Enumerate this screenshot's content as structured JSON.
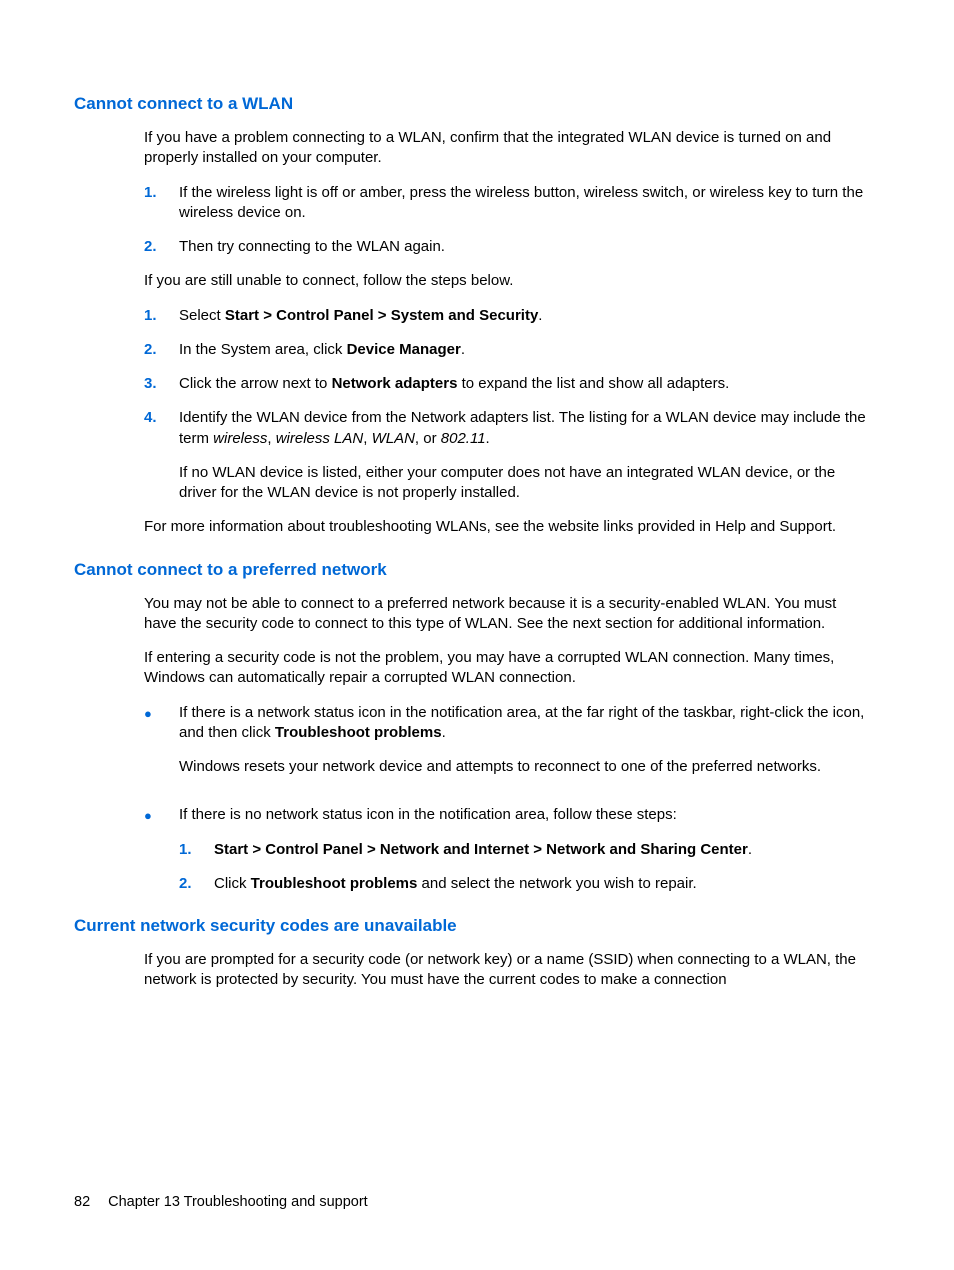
{
  "sections": [
    {
      "heading": "Cannot connect to a WLAN",
      "intro": "If you have a problem connecting to a WLAN, confirm that the integrated WLAN device is turned on and properly installed on your computer.",
      "list1": [
        "If the wireless light is off or amber, press the wireless button, wireless switch, or wireless key to turn the wireless device on.",
        "Then try connecting to the WLAN again."
      ],
      "mid": "If you are still unable to connect, follow the steps below.",
      "list2_item1_pre": "Select ",
      "list2_item1_bold": "Start > Control Panel > System and Security",
      "list2_item1_post": ".",
      "list2_item2_pre": "In the System area, click ",
      "list2_item2_bold": "Device Manager",
      "list2_item2_post": ".",
      "list2_item3_pre": "Click the arrow next to ",
      "list2_item3_bold": "Network adapters",
      "list2_item3_post": " to expand the list and show all adapters.",
      "list2_item4_p1_pre": "Identify the WLAN device from the Network adapters list. The listing for a WLAN device may include the term ",
      "list2_item4_i1": "wireless",
      "list2_item4_s1": ", ",
      "list2_item4_i2": "wireless LAN",
      "list2_item4_s2": ", ",
      "list2_item4_i3": "WLAN",
      "list2_item4_s3": ", or ",
      "list2_item4_i4": "802.11",
      "list2_item4_s4": ".",
      "list2_item4_p2": "If no WLAN device is listed, either your computer does not have an integrated WLAN device, or the driver for the WLAN device is not properly installed.",
      "outro": "For more information about troubleshooting WLANs, see the website links provided in Help and Support."
    },
    {
      "heading": "Cannot connect to a preferred network",
      "p1": "You may not be able to connect to a preferred network because it is a security-enabled WLAN. You must have the security code to connect to this type of WLAN. See the next section for additional information.",
      "p2": "If entering a security code is not the problem, you may have a corrupted WLAN connection. Many times, Windows can automatically repair a corrupted WLAN connection.",
      "bullet1_p1_pre": "If there is a network status icon in the notification area, at the far right of the taskbar, right-click the icon, and then click ",
      "bullet1_p1_bold": "Troubleshoot problems",
      "bullet1_p1_post": ".",
      "bullet1_p2": "Windows resets your network device and attempts to reconnect to one of the preferred networks.",
      "bullet2_intro": "If there is no network status icon in the notification area, follow these steps:",
      "bullet2_step1_bold": "Start > Control Panel > Network and Internet > Network and Sharing Center",
      "bullet2_step1_post": ".",
      "bullet2_step2_pre": "Click ",
      "bullet2_step2_bold": "Troubleshoot problems",
      "bullet2_step2_post": " and select the network you wish to repair."
    },
    {
      "heading": "Current network security codes are unavailable",
      "p1": "If you are prompted for a security code (or network key) or a name (SSID) when connecting to a WLAN, the network is protected by security. You must have the current codes to make a connection"
    }
  ],
  "footer": {
    "page": "82",
    "chapter": "Chapter 13   Troubleshooting and support"
  },
  "nums": {
    "n1": "1.",
    "n2": "2.",
    "n3": "3.",
    "n4": "4."
  },
  "bullet": "●"
}
